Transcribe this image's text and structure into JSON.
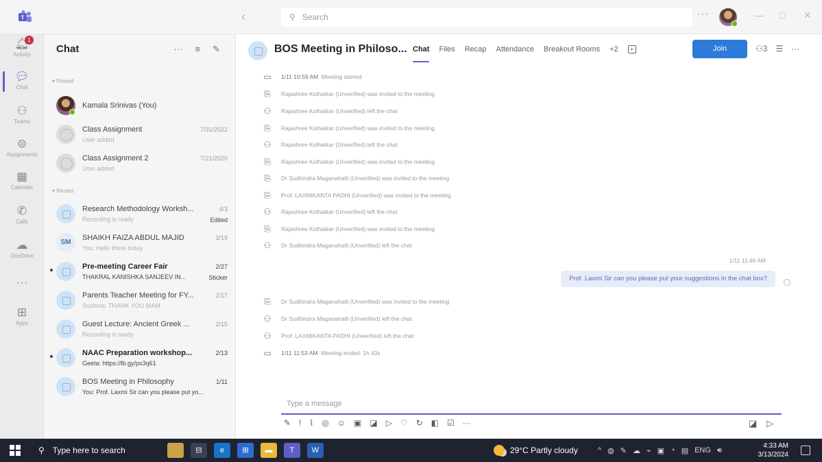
{
  "titlebar": {
    "search_placeholder": "Search",
    "more": "···",
    "back": "‹",
    "minimize": "—",
    "maximize": "□",
    "close": "✕"
  },
  "rail": {
    "items": [
      {
        "label": "Activity",
        "icon": "bell-icon",
        "badge": "1"
      },
      {
        "label": "Chat",
        "icon": "chat-icon"
      },
      {
        "label": "Teams",
        "icon": "teams-icon"
      },
      {
        "label": "Assignments",
        "icon": "assignments-icon"
      },
      {
        "label": "Calendar",
        "icon": "calendar-icon"
      },
      {
        "label": "Calls",
        "icon": "phone-icon"
      },
      {
        "label": "OneDrive",
        "icon": "cloud-icon"
      },
      {
        "label": "",
        "icon": "more-icon"
      },
      {
        "label": "Apps",
        "icon": "add-apps-icon"
      }
    ]
  },
  "chatlist": {
    "title": "Chat",
    "pinned_label": "Pinned",
    "recent_label": "Recent",
    "pinned": [
      {
        "name": "Kamala Srinivas (You)",
        "preview": "",
        "date": ""
      },
      {
        "name": "Class Assignment",
        "preview": "User added",
        "date": "7/31/2022"
      },
      {
        "name": "Class Assignment 2",
        "preview": "User added",
        "date": "7/21/2020"
      }
    ],
    "recent": [
      {
        "name": "Research Methodology Worksh...",
        "preview": "Recording is ready",
        "date": "4/3",
        "extra": "Edited",
        "avatar": ""
      },
      {
        "name": "SHAIKH FAIZA ABDUL MAJID",
        "preview": "You: Hello there today",
        "date": "3/19",
        "avatar": "SM"
      },
      {
        "name": "Pre-meeting Career Fair",
        "preview": "THAKRAL KANISHKA SANJEEV IN...",
        "date": "2/27",
        "extra": "Sticker",
        "avatar": ""
      },
      {
        "name": "Parents Teacher Meeting for FY...",
        "preview": "Sushma: THANK YOU MAM",
        "date": "2/17",
        "avatar": ""
      },
      {
        "name": "Guest Lecture: Ancient Greek ...",
        "preview": "Recording is ready",
        "date": "2/15",
        "avatar": ""
      },
      {
        "name": "NAAC Preparation workshop...",
        "preview": "Geeta: https://lb.gy/px3q61",
        "date": "2/13",
        "avatar": ""
      },
      {
        "name": "BOS Meeting in Philosophy",
        "preview": "You: Prof. Laxmi Sir can you please put yo...",
        "date": "1/11",
        "avatar": ""
      }
    ]
  },
  "main": {
    "title": "BOS Meeting in Philoso...",
    "tabs": [
      "Chat",
      "Files",
      "Recap",
      "Attendance",
      "Breakout Rooms",
      "+2"
    ],
    "join_label": "Join",
    "participants_count": "3",
    "events": [
      {
        "icon": "meeting-icon",
        "time": "1/11 10:59 AM",
        "text": "Meeting started"
      },
      {
        "icon": "invite-icon",
        "name": "Rajashree Kolhatkar (Unverified)",
        "text": "was invited to the meeting"
      },
      {
        "icon": "left-chat-icon",
        "name": "Rajashree Kolhatkar (Unverified)",
        "text": "left the chat"
      },
      {
        "icon": "invite-icon",
        "name": "Rajashree Kolhatkar (Unverified)",
        "text": "was invited to the meeting"
      },
      {
        "icon": "left-chat-icon",
        "name": "Rajashree Kolhatkar (Unverified)",
        "text": "left the chat"
      },
      {
        "icon": "invite-icon",
        "name": "Rajashree Kolhatkar (Unverified)",
        "text": "was invited to the meeting"
      },
      {
        "icon": "invite-icon",
        "name": "Dr Sudhindra Maganahalli (Unverified)",
        "text": "was invited to the meeting"
      },
      {
        "icon": "invite-icon",
        "name": "Prof. LAXMIKANTA PADHI (Unverified)",
        "text": "was invited to the meeting"
      },
      {
        "icon": "left-chat-icon",
        "name": "Rajashree Kolhatkar (Unverified)",
        "text": "left the chat"
      },
      {
        "icon": "invite-icon",
        "name": "Rajashree Kolhatkar (Unverified)",
        "text": "was invited to the meeting"
      },
      {
        "icon": "left-chat-icon",
        "name": "Dr Sudhindra Maganahalli (Unverified)",
        "text": "left the chat"
      },
      {
        "icon": "invite-icon",
        "name": "Dr Sudhindra Maganahalli (Unverified)",
        "text": "was invited to the meeting"
      },
      {
        "icon": "left-chat-icon",
        "name": "Dr Sudhindra Maganahalli (Unverified)",
        "text": "left the chat"
      },
      {
        "icon": "left-chat-icon",
        "name": "Prof. LAXMIKANTA PADHI (Unverified)",
        "text": "left the chat"
      },
      {
        "icon": "meeting-icon",
        "time": "1/11 11:53 AM",
        "text": "Meeting ended: 1h 43s"
      }
    ],
    "sent_time": "1/11 11:46 AM",
    "sent_message": "Prof. Laxmi Sir can you please put your suggestions in the chat box?"
  },
  "compose": {
    "placeholder": "Type a message"
  },
  "taskbar": {
    "search_placeholder": "Type here to search",
    "weather": "29°C  Partly cloudy",
    "time": "4:33 AM",
    "date": "3/13/2024"
  }
}
